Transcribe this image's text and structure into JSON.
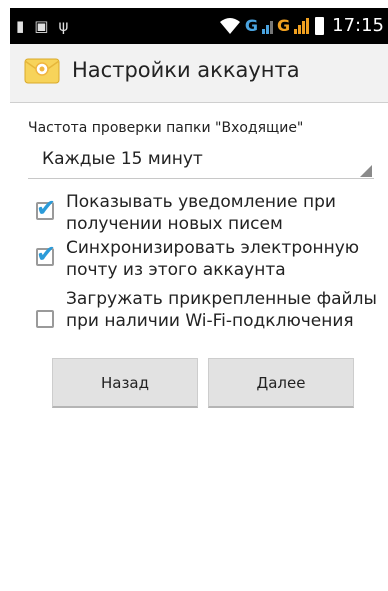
{
  "status_bar": {
    "time": "17:15",
    "network_1": "G",
    "network_2": "G",
    "icons": [
      "sim-icon",
      "image-icon",
      "usb-icon",
      "wifi-icon",
      "signal-icon",
      "battery-icon"
    ]
  },
  "action_bar": {
    "title": "Настройки аккаунта",
    "icon": "email-envelope-icon"
  },
  "settings": {
    "frequency_label": "Частота проверки папки \"Входящие\"",
    "frequency_value": "Каждые 15 минут",
    "options": [
      {
        "label": "Показывать уведомление при получении новых писем",
        "checked": true
      },
      {
        "label": "Синхронизировать электронную почту из этого аккаунта",
        "checked": true
      },
      {
        "label": "Загружать прикрепленные файлы при наличии Wi-Fi-подключения",
        "checked": false
      }
    ]
  },
  "buttons": {
    "back": "Назад",
    "next": "Далее"
  },
  "colors": {
    "accent": "#2b9bd9",
    "status_bar": "#000000",
    "action_bar": "#f2f2f2",
    "button": "#e2e2e2"
  }
}
